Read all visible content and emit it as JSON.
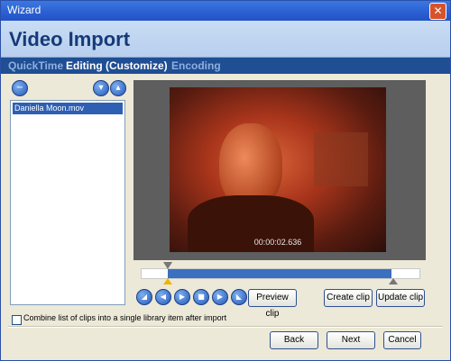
{
  "window": {
    "title": "Wizard",
    "close_icon": "close-icon"
  },
  "header": {
    "title": "Video Import"
  },
  "steps": [
    {
      "label": "QuickTime",
      "state": "inactive"
    },
    {
      "label": "Editing (Customize)",
      "state": "active"
    },
    {
      "label": "Encoding",
      "state": "inactive"
    }
  ],
  "clip_list": {
    "items": [
      "Daniella Moon.mov"
    ],
    "remove_icon": "minus-icon",
    "move_down_icon": "down-arrow-icon",
    "move_up_icon": "up-arrow-icon"
  },
  "preview": {
    "timecode": "00:00:02.636"
  },
  "playback_controls": [
    {
      "name": "jump-to-start-icon",
      "glyph": "◢"
    },
    {
      "name": "step-back-icon",
      "glyph": "◀"
    },
    {
      "name": "play-icon",
      "glyph": "▶"
    },
    {
      "name": "stop-icon",
      "glyph": "■"
    },
    {
      "name": "step-forward-icon",
      "glyph": "▶"
    },
    {
      "name": "jump-to-end-icon",
      "glyph": "◣"
    }
  ],
  "buttons": {
    "preview_clip": "Preview clip",
    "create_clip": "Create clip",
    "update_clip": "Update clip",
    "back": "Back",
    "next": "Next",
    "cancel": "Cancel"
  },
  "options": {
    "combine_label": "Combine list of clips into a single library item after import",
    "combine_checked": false
  },
  "colors": {
    "header_blue": "#1f4e93",
    "selection_blue": "#2e5fb3",
    "title_text": "#163a78"
  }
}
